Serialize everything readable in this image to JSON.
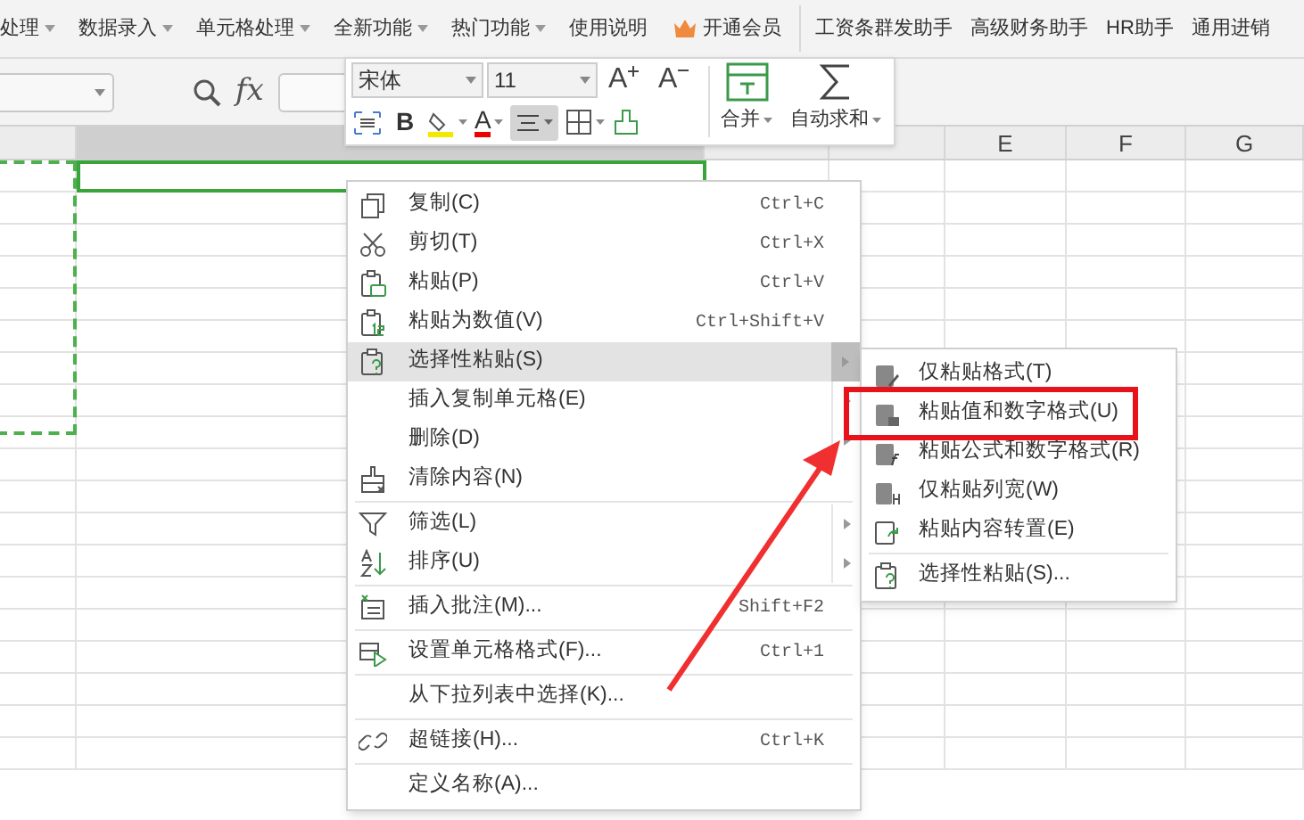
{
  "menu_bar": [
    {
      "label": "处理",
      "dropdown": true
    },
    {
      "label": "数据录入",
      "dropdown": true
    },
    {
      "label": "单元格处理",
      "dropdown": true
    },
    {
      "label": "全新功能",
      "dropdown": true
    },
    {
      "label": "热门功能",
      "dropdown": true
    },
    {
      "label": "使用说明",
      "dropdown": false
    }
  ],
  "vip": {
    "label": "开通会员"
  },
  "helpers": [
    "工资条群发助手",
    "高级财务助手",
    "HR助手",
    "通用进销"
  ],
  "formula_bar": {
    "function_label": "fx"
  },
  "mini_toolbar": {
    "font": "宋体",
    "size": "11",
    "grow_label": "A",
    "shrink_label": "A",
    "bold_label": "B",
    "color_label": "A",
    "align_pressed": true,
    "merge": "合并",
    "autosum": "自动求和"
  },
  "columns": [
    {
      "selected": false
    },
    {
      "selected": true
    },
    {
      "selected": false
    },
    {
      "selected": false
    },
    {
      "label": "E",
      "selected": false
    },
    {
      "label": "F",
      "selected": false
    },
    {
      "label": "G",
      "selected": false
    }
  ],
  "context_menu": [
    {
      "label": "复制(C)",
      "shortcut": "Ctrl+C",
      "submenu": false,
      "selected": false,
      "separator_after": false
    },
    {
      "label": "剪切(T)",
      "shortcut": "Ctrl+X",
      "submenu": false,
      "selected": false,
      "separator_after": false
    },
    {
      "label": "粘贴(P)",
      "shortcut": "Ctrl+V",
      "submenu": false,
      "selected": false,
      "separator_after": false
    },
    {
      "label": "粘贴为数值(V)",
      "shortcut": "Ctrl+Shift+V",
      "submenu": false,
      "selected": false,
      "separator_after": false
    },
    {
      "label": "选择性粘贴(S)",
      "submenu": true,
      "selected": true,
      "separator_after": false
    },
    {
      "label": "插入复制单元格(E)",
      "submenu": true,
      "selected": false,
      "separator_after": false
    },
    {
      "label": "删除(D)",
      "submenu": true,
      "selected": false,
      "separator_after": false
    },
    {
      "label": "清除内容(N)",
      "submenu": false,
      "selected": false,
      "separator_after": true
    },
    {
      "label": "筛选(L)",
      "submenu": true,
      "selected": false,
      "separator_after": false
    },
    {
      "label": "排序(U)",
      "submenu": true,
      "selected": false,
      "separator_after": true
    },
    {
      "label": "插入批注(M)...",
      "shortcut": "Shift+F2",
      "submenu": false,
      "selected": false,
      "separator_after": true
    },
    {
      "label": "设置单元格格式(F)...",
      "shortcut": "Ctrl+1",
      "submenu": false,
      "selected": false,
      "separator_after": true
    },
    {
      "label": "从下拉列表中选择(K)...",
      "submenu": false,
      "selected": false,
      "separator_after": true
    },
    {
      "label": "超链接(H)...",
      "shortcut": "Ctrl+K",
      "submenu": false,
      "selected": false,
      "separator_after": true
    },
    {
      "label": "定义名称(A)...",
      "submenu": false,
      "selected": false,
      "separator_after": false
    }
  ],
  "submenu": [
    {
      "label": "仅粘贴格式(T)",
      "annotated": false,
      "separator_after": false
    },
    {
      "label": "粘贴值和数字格式(U)",
      "annotated": true,
      "separator_after": false
    },
    {
      "label": "粘贴公式和数字格式(R)",
      "annotated": false,
      "separator_after": false
    },
    {
      "label": "仅粘贴列宽(W)",
      "annotated": false,
      "separator_after": false
    },
    {
      "label": "粘贴内容转置(E)",
      "annotated": false,
      "separator_after": true
    },
    {
      "label": "选择性粘贴(S)...",
      "annotated": false,
      "separator_after": false
    }
  ]
}
